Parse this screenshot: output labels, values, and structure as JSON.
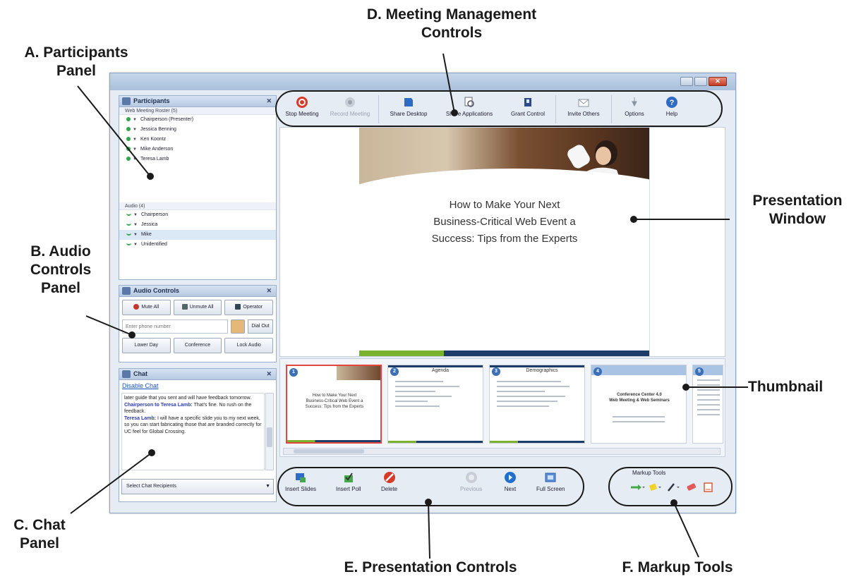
{
  "callouts": {
    "participants": "A. Participants\nPanel",
    "audio": "B. Audio\nControls\nPanel",
    "chat": "C. Chat\nPanel",
    "meeting_management": "D. Meeting Management\nControls",
    "presentation_window": "Presentation\nWindow",
    "thumbnail": "Thumbnail",
    "presentation_controls": "E. Presentation Controls",
    "markup_tools": "F. Markup Tools"
  },
  "participants_panel": {
    "title": "Participants",
    "group1_label": "Web Meeting Roster (5)",
    "group1": [
      "Chairperson (Presenter)",
      "Jessica Benning",
      "Ken Koontz",
      "Mike Anderson",
      "Teresa Lamb"
    ],
    "group2_label": "Audio (4)",
    "group2": [
      "Chairperson",
      "Jessica",
      "Mike",
      "Unidentified"
    ]
  },
  "audio_panel": {
    "title": "Audio Controls",
    "mute_all": "Mute All",
    "unmute_all": "Unmute All",
    "operator": "Operator",
    "dial_placeholder": "Enter phone number",
    "dialout": "Dial Out",
    "lower_day": "Lower Day",
    "conference": "Conference",
    "lock_audio": "Lock Audio"
  },
  "chat_panel": {
    "title": "Chat",
    "disable_link": "Disable Chat",
    "messages": [
      {
        "who": "",
        "text": "later guide that you sent and will have feedback tomorrow."
      },
      {
        "who": "Chairperson to Teresa Lamb:",
        "text": "That's fine. No rush on the feedback."
      },
      {
        "who": "Teresa Lamb:",
        "text": "I will have a specific slide you to my next week, so you can start fabricating those that are branded correctly for UC feel for Global Crossing."
      }
    ],
    "recipient": "Select Chat Recipients"
  },
  "toolbar": {
    "stop_meeting": "Stop Meeting",
    "record_meeting": "Record Meeting",
    "share_desktop": "Share Desktop",
    "share_applications": "Share Applications",
    "grant_control": "Grant Control",
    "invite_others": "Invite Others",
    "options": "Options",
    "help": "Help"
  },
  "slide": {
    "title": "How to Make Your Next\nBusiness-Critical Web Event a\nSuccess: Tips from the Experts"
  },
  "thumbnails": [
    {
      "num": "1",
      "title": "",
      "text": "How to Make Your Next\nBusiness-Critical Web Event a\nSuccess: Tips from the Experts"
    },
    {
      "num": "2",
      "title": "Agenda",
      "text": ""
    },
    {
      "num": "3",
      "title": "Demographics",
      "text": ""
    },
    {
      "num": "4",
      "title": "",
      "text": "Conference Center 4.0\nWeb Meeting & Web Seminars"
    },
    {
      "num": "5",
      "title": "",
      "text": ""
    }
  ],
  "presentation_controls": {
    "insert_slides": "Insert Slides",
    "insert_poll": "Insert Poll",
    "delete": "Delete",
    "previous": "Previous",
    "next": "Next",
    "full_screen": "Full Screen"
  },
  "markup": {
    "title": "Markup Tools"
  },
  "colors": {
    "accent_blue": "#1d3c6a",
    "accent_green": "#7ab22e",
    "stop_red": "#d83a2a",
    "selected_thumb": "#e2463c"
  }
}
